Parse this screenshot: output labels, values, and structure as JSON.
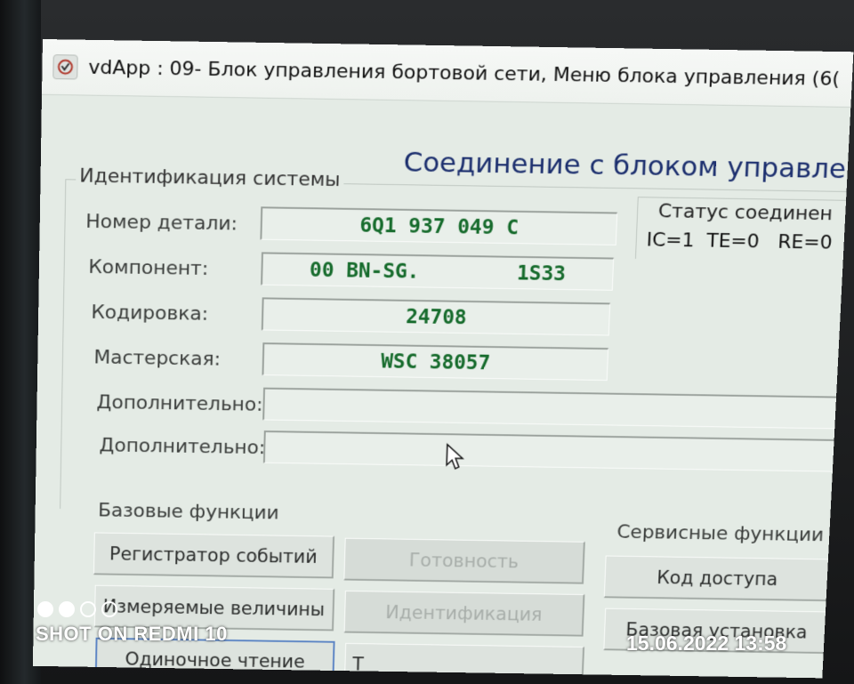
{
  "window": {
    "title": "vdApp : 09- Блок управления бортовой сети,  Меню блока управления (6("
  },
  "header": {
    "connection_title": "Соединение с блоком управления"
  },
  "identification": {
    "legend": "Идентификация системы",
    "fields": [
      {
        "label": "Номер детали:",
        "value": "6Q1 937 049 C"
      },
      {
        "label": "Компонент:",
        "value": "00 BN-SG.        1S33"
      },
      {
        "label": "Кодировка:",
        "value": "24708"
      },
      {
        "label": "Мастерская:",
        "value": "WSC 38057"
      },
      {
        "label": "Дополнительно:",
        "value": ""
      },
      {
        "label": "Дополнительно:",
        "value": ""
      }
    ]
  },
  "status": {
    "label": "Статус соединен",
    "value": "IC=1  TE=0   RE=0"
  },
  "basic_functions": {
    "label": "Базовые функции",
    "buttons": [
      {
        "label": "Регистратор событий"
      },
      {
        "label": "Готовность"
      },
      {
        "label": "Измеряемые величины"
      },
      {
        "label": "Идентификация"
      },
      {
        "label": "Одиночное чтение"
      },
      {
        "label": "Т"
      }
    ]
  },
  "service_functions": {
    "label": "Сервисные функции",
    "buttons": [
      {
        "label": "Код доступа"
      },
      {
        "label": "Базовая установка"
      }
    ]
  },
  "overlay": {
    "shot_on": "SHOT ON REDMI 10",
    "timestamp": "15.06.2022  13:58"
  }
}
